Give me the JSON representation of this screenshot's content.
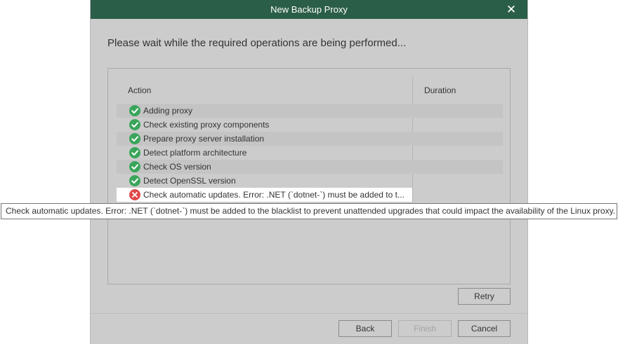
{
  "dialog": {
    "title": "New Backup Proxy",
    "close_icon": "close-icon",
    "heading": "Please wait while the required operations are being performed..."
  },
  "table": {
    "columns": [
      "Action",
      "Duration"
    ],
    "rows": [
      {
        "status": "success",
        "icon": "check-circle-icon",
        "label": "Adding proxy",
        "duration": ""
      },
      {
        "status": "success",
        "icon": "check-circle-icon",
        "label": "Check existing proxy components",
        "duration": ""
      },
      {
        "status": "success",
        "icon": "check-circle-icon",
        "label": "Prepare proxy server installation",
        "duration": ""
      },
      {
        "status": "success",
        "icon": "check-circle-icon",
        "label": "Detect platform architecture",
        "duration": ""
      },
      {
        "status": "success",
        "icon": "check-circle-icon",
        "label": "Check OS version",
        "duration": ""
      },
      {
        "status": "success",
        "icon": "check-circle-icon",
        "label": "Detect OpenSSL version",
        "duration": ""
      },
      {
        "status": "error",
        "icon": "error-circle-icon",
        "label": "Check automatic updates. Error: .NET (`dotnet-`) must be added to t...",
        "duration": ""
      }
    ]
  },
  "tooltip": {
    "text": "Check automatic updates. Error: .NET (`dotnet-`) must be added to the blacklist to prevent unattended upgrades that could impact the availability of the Linux proxy."
  },
  "buttons": {
    "retry": "Retry",
    "back": "Back",
    "finish": "Finish",
    "cancel": "Cancel"
  },
  "colors": {
    "titlebar": "#2b5e48",
    "success": "#3aa55a",
    "error": "#e04848",
    "dialog_bg": "#cccccc"
  }
}
